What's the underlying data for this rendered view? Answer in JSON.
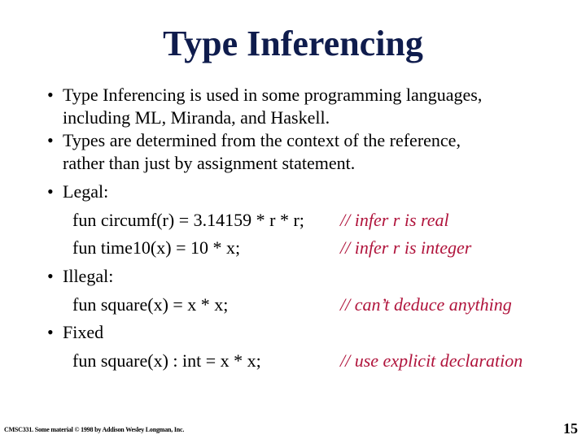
{
  "slide": {
    "title": "Type Inferencing",
    "bullets": [
      {
        "symbol": "•",
        "lines": [
          "Type Inferencing  is used in some programming languages,",
          "including ML, Miranda, and Haskell."
        ]
      },
      {
        "symbol": "•",
        "lines": [
          "Types are determined from the context of the reference,",
          "rather than just by assignment statement."
        ]
      },
      {
        "symbol": "•",
        "lines": [
          "Legal:"
        ]
      },
      {
        "symbol": "•",
        "lines": [
          "Illegal:"
        ]
      },
      {
        "symbol": "•",
        "lines": [
          "Fixed"
        ]
      }
    ],
    "code": {
      "legal_1": "fun circumf(r) = 3.14159 * r * r;",
      "legal_1_comment": "// infer r is real",
      "legal_2": "fun time10(x) = 10 * x;",
      "legal_2_comment": "// infer r is integer",
      "illegal_1": "fun square(x) = x * x;",
      "illegal_1_comment": "// can’t deduce anything",
      "fixed_1": "fun square(x) : int = x * x;",
      "fixed_1_comment": "// use explicit declaration"
    },
    "footer": "CMSC331.  Some material © 1998 by Addison Wesley Longman, Inc.",
    "page_number": "15",
    "colors": {
      "title": "#0f1c4d",
      "comment": "#b0143c",
      "text": "#000000"
    }
  }
}
